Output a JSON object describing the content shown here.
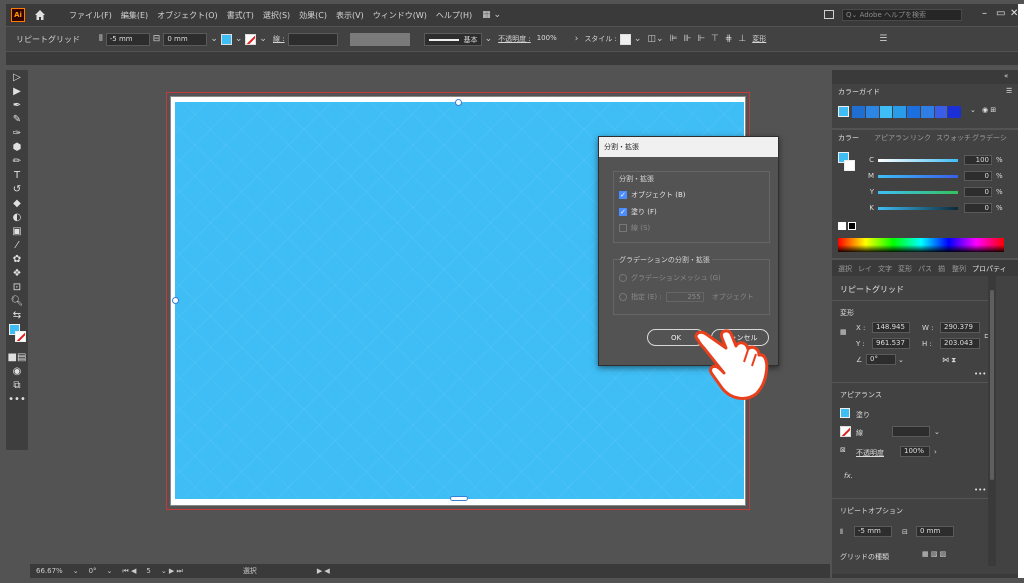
{
  "app": {
    "logo": "Ai"
  },
  "menu": [
    "ファイル(F)",
    "編集(E)",
    "オブジェクト(O)",
    "書式(T)",
    "選択(S)",
    "効果(C)",
    "表示(V)",
    "ウィンドウ(W)",
    "ヘルプ(H)"
  ],
  "search": {
    "placeholder": "Adobe ヘルプを検索"
  },
  "control": {
    "title": "リピートグリッド",
    "h_spacing": "-5 mm",
    "v_spacing": "0 mm",
    "stroke_label": "線 :",
    "stroke_style": "基本",
    "opacity_label": "不透明度 :",
    "opacity": "100%",
    "style_label": "スタイル :",
    "transform_label": "変形"
  },
  "dialog": {
    "title": "分割・拡張",
    "section1": "分割・拡張",
    "object": "オブジェクト (B)",
    "fill": "塗り (F)",
    "stroke": "線 (S)",
    "section2": "グラデーションの分割・拡張",
    "gradient_mesh": "グラデーションメッシュ (G)",
    "specify": "指定 (E) :",
    "specify_value": "255",
    "objects_label": "オブジェクト",
    "ok": "OK",
    "cancel": "キャンセル"
  },
  "panels": {
    "colorguide_tab": "カラーガイド",
    "color_tabs": [
      "カラー",
      "アピアラン",
      "リンク",
      "スウォッチ",
      "グラデーシ"
    ],
    "cmyk": [
      {
        "label": "C",
        "value": "100",
        "color": "#3fbdf5"
      },
      {
        "label": "M",
        "value": "0",
        "color": "#ff3fbd"
      },
      {
        "label": "Y",
        "value": "0",
        "color": "#ffee00"
      },
      {
        "label": "K",
        "value": "0",
        "color": "#000000"
      }
    ],
    "pct": "%",
    "prop_tabs": [
      "選択",
      "レイ",
      "文字",
      "変形",
      "パス",
      "揃",
      "整列",
      "プロパティ"
    ],
    "prop_title": "リピートグリッド",
    "transform": "変形",
    "x_label": "X :",
    "x": "148.945",
    "w_label": "W :",
    "w": "290.379",
    "y_label": "Y :",
    "y": "961.537",
    "h_label": "H :",
    "h": "203.043",
    "angle": "0°",
    "appearance": "アピアランス",
    "fill_label": "塗り",
    "stroke_label": "線",
    "opacity_label": "不透明度",
    "opacity": "100%",
    "fx": "fx.",
    "repeat_options": "リピートオプション",
    "rh_spacing": "-5 mm",
    "rv_spacing": "0 mm",
    "grid_type": "グリッドの種類"
  },
  "status": {
    "zoom": "66.67%",
    "rotation": "0°",
    "artboard": "5",
    "tool": "選択"
  },
  "colors": {
    "accent": "#3fbdf5",
    "bleed": "#c43a3a"
  }
}
